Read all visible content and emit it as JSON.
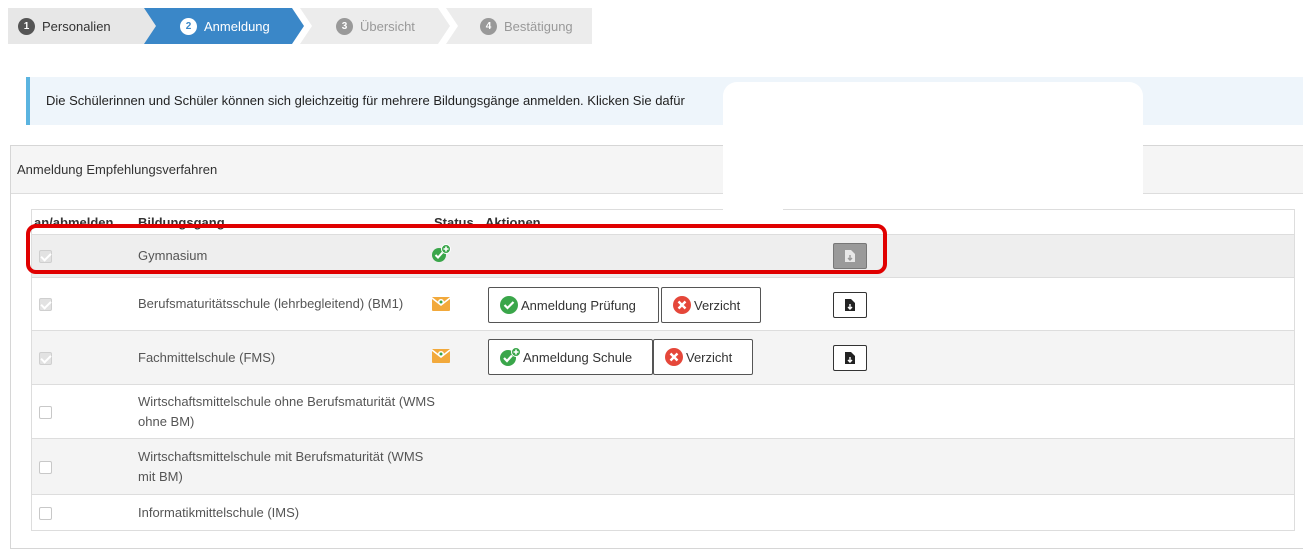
{
  "wizard": {
    "steps": [
      {
        "num": "1",
        "label": "Personalien"
      },
      {
        "num": "2",
        "label": "Anmeldung"
      },
      {
        "num": "3",
        "label": "Übersicht"
      },
      {
        "num": "4",
        "label": "Bestätigung"
      }
    ]
  },
  "info": {
    "text": "Die Schülerinnen und Schüler können sich gleichzeitig für mehrere Bildungsgänge anmelden. Klicken Sie dafür"
  },
  "panel": {
    "title": "Anmeldung Empfehlungsverfahren",
    "columns": [
      "an/abmelden",
      "Bildungsgang",
      "Status",
      "Aktionen"
    ],
    "rows": [
      {
        "program": "Gymnasium",
        "checked": true,
        "status": "check-plus-icon"
      },
      {
        "program": "Berufsmaturitätsschule (lehrbegleitend) (BM1)",
        "checked": true,
        "status": "envelope-icon",
        "action1": "Anmeldung Prüfung",
        "action2": "Verzicht"
      },
      {
        "program": "Fachmittelschule (FMS)",
        "checked": true,
        "status": "envelope-icon",
        "action1": "Anmeldung Schule",
        "action2": "Verzicht"
      },
      {
        "program": "Wirtschaftsmittelschule ohne Berufsmaturität (WMS ohne BM)",
        "checked": false
      },
      {
        "program": "Wirtschaftsmittelschule mit Berufsmaturität (WMS mit BM)",
        "checked": false
      },
      {
        "program": "Informatikmittelschule (IMS)",
        "checked": false
      }
    ]
  },
  "colors": {
    "active_step": "#3a87c8",
    "info_border": "#5bb4e0",
    "highlight": "#e00000",
    "check_green": "#3aa64a",
    "cancel_red": "#e5473a"
  }
}
